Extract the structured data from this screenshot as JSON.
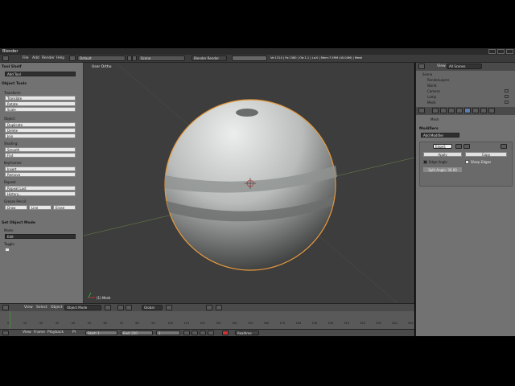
{
  "window": {
    "title": "Blender"
  },
  "info": {
    "menus": [
      "File",
      "Add",
      "Render",
      "Help"
    ],
    "layout": "Default",
    "scene": "Scene",
    "engine": "Blender Render",
    "stats": "Ve:1314 | Fa:1360 | Ob:1-1 | La:0 | Mem:7.59M (40.04M) | Mesh"
  },
  "toolshelf": {
    "header1": "Tool Shelf",
    "add_tool": "Add Tool",
    "object_tools": "Object Tools",
    "transform": "Transform:",
    "transform_items": [
      "Translate",
      "Rotate",
      "Scale"
    ],
    "object_label": "Object:",
    "object_items": [
      "Duplicate",
      "Delete",
      "Join"
    ],
    "shading_label": "Shading:",
    "shading_items": [
      "Smooth",
      "Flat"
    ],
    "keyframes_label": "Keyframes:",
    "keyframes_items": [
      "Insert",
      "Remove"
    ],
    "repeat_label": "Repeat:",
    "repeat_items": [
      "Repeat Last",
      "History..."
    ],
    "grease_label": "Grease Pencil:",
    "grease_items": [
      "Draw",
      "Line",
      "Erase"
    ],
    "set_mode": "Set Object Mode",
    "mode_label": "Mode:",
    "mode_value": "Edit",
    "toggle_label": "Toggle"
  },
  "viewport": {
    "view_label": "User Ortho",
    "object_label": "(1) Mesh",
    "sphere_color": "#d9dcdb",
    "outline_color": "#e69a3c"
  },
  "view_header": {
    "menus": [
      "View",
      "Select",
      "Object"
    ],
    "mode": "Object Mode",
    "orientation": "Global"
  },
  "timeline": {
    "ticks": [
      "0",
      "10",
      "20",
      "30",
      "40",
      "50",
      "60",
      "70",
      "80",
      "90",
      "100",
      "110",
      "120",
      "130",
      "140",
      "150",
      "160",
      "170",
      "180",
      "190",
      "200",
      "210",
      "220",
      "230",
      "240",
      "250"
    ],
    "menus": [
      "View",
      "Frame",
      "Playback",
      "Pr"
    ],
    "start": "Start: 1",
    "end": "End: 250",
    "current": "1",
    "sync": "Realtime"
  },
  "outliner": {
    "view": "View",
    "search": "All Scenes",
    "items": [
      "Scene",
      "RenderLayers",
      "World",
      "Camera",
      "Lamp",
      "Mesh"
    ]
  },
  "properties": {
    "context": "Mesh",
    "modifiers": "Modifiers",
    "add_modifier": "Add Modifier",
    "modifier_name": "EdgeS",
    "apply": "Apply",
    "copy": "Copy",
    "edge_angle": "Edge Angle",
    "sharp_edges": "Sharp Edges",
    "split_angle": "Split Angle: 30.00"
  }
}
